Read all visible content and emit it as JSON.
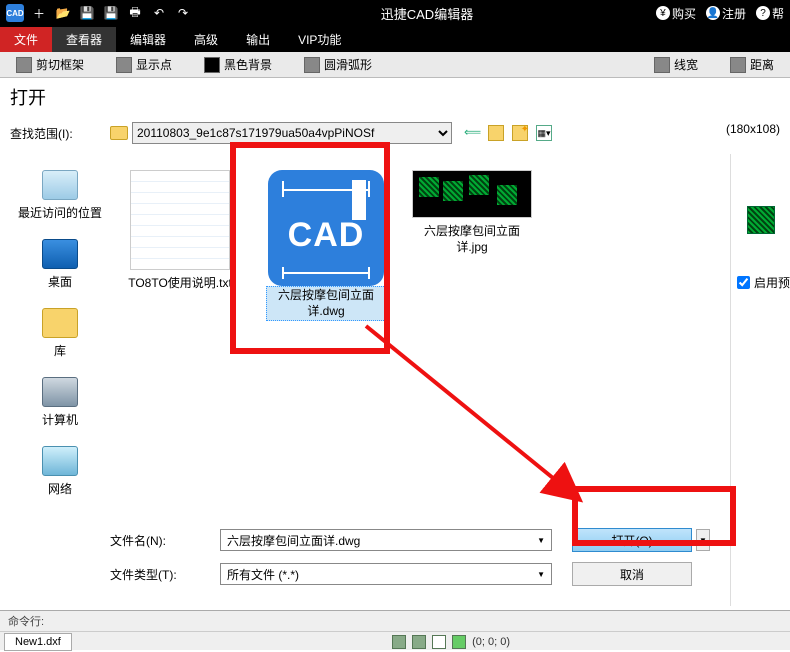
{
  "titlebar": {
    "app_title": "迅捷CAD编辑器",
    "buy": "购买",
    "register": "注册",
    "help": "帮"
  },
  "menu": {
    "file": "文件",
    "viewer": "查看器",
    "editor": "编辑器",
    "advanced": "高级",
    "output": "输出",
    "vip": "VIP功能"
  },
  "toolbar": {
    "crop": "剪切框架",
    "showpoint": "显示点",
    "blackbg": "黑色背景",
    "smootharc": "圆滑弧形",
    "linewidth": "线宽",
    "distance": "距离"
  },
  "dialog": {
    "title": "打开",
    "lookin_label": "查找范围(I):",
    "lookin_value": "20110803_9e1c87s171979ua50a4vpPiNOSf",
    "preview_dims": "(180x108)",
    "enable_preview": "启用预"
  },
  "places": {
    "recent": "最近访问的位置",
    "desktop": "桌面",
    "library": "库",
    "computer": "计算机",
    "network": "网络"
  },
  "files": {
    "f1": "TO8TO使用说明.txt",
    "f2": "六层按摩包间立面详.dwg",
    "f3": "六层按摩包间立面详.jpg"
  },
  "bottom": {
    "name_label": "文件名(N):",
    "name_value": "六层按摩包间立面详.dwg",
    "type_label": "文件类型(T):",
    "type_value": "所有文件 (*.*)",
    "open_btn": "打开(O)",
    "cancel_btn": "取消"
  },
  "status": {
    "cmd_label": "命令行:",
    "doc_tab": "New1.dxf",
    "coords": "(0; 0; 0)"
  }
}
